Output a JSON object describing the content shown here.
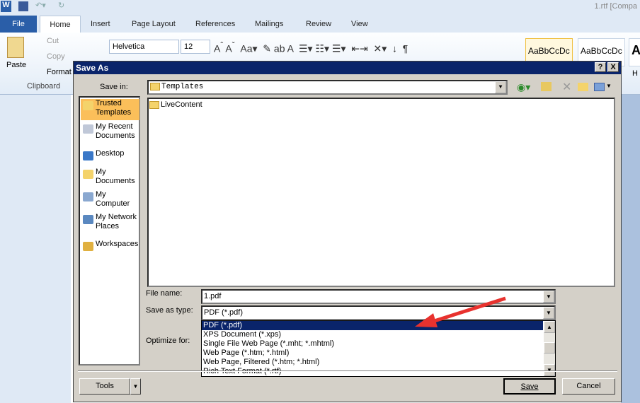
{
  "word": {
    "title": "1.rtf [Compa",
    "tabs": [
      "File",
      "Home",
      "Insert",
      "Page Layout",
      "References",
      "Mailings",
      "Review",
      "View"
    ],
    "clipboard": {
      "paste": "Paste",
      "cut": "Cut",
      "copy": "Copy",
      "format": "Format",
      "group": "Clipboard"
    },
    "font": "Helvetica",
    "size": "12",
    "styles": [
      "AaBbCcDc",
      "AaBbCcDc",
      "A"
    ],
    "style_label": "H"
  },
  "dialog": {
    "title": "Save As",
    "help": "?",
    "close": "X",
    "save_in_label": "Save in:",
    "save_in": "Templates",
    "places": [
      "Trusted Templates",
      "My Recent Documents",
      "Desktop",
      "My Documents",
      "My Computer",
      "My Network Places",
      "Workspaces"
    ],
    "files": [
      "LiveContent"
    ],
    "file_name_label": "File name:",
    "file_name": "1.pdf",
    "type_label": "Save as type:",
    "type": "PDF (*.pdf)",
    "optimize_label": "Optimize for:",
    "type_options": [
      "PDF (*.pdf)",
      "XPS Document (*.xps)",
      "Single File Web Page (*.mht; *.mhtml)",
      "Web Page (*.htm; *.html)",
      "Web Page, Filtered (*.htm; *.html)",
      "Rich Text Format (*.rtf)"
    ],
    "tools": "Tools",
    "save": "Save",
    "cancel": "Cancel"
  },
  "annotation": {
    "arrow_color": "#e8322e"
  }
}
